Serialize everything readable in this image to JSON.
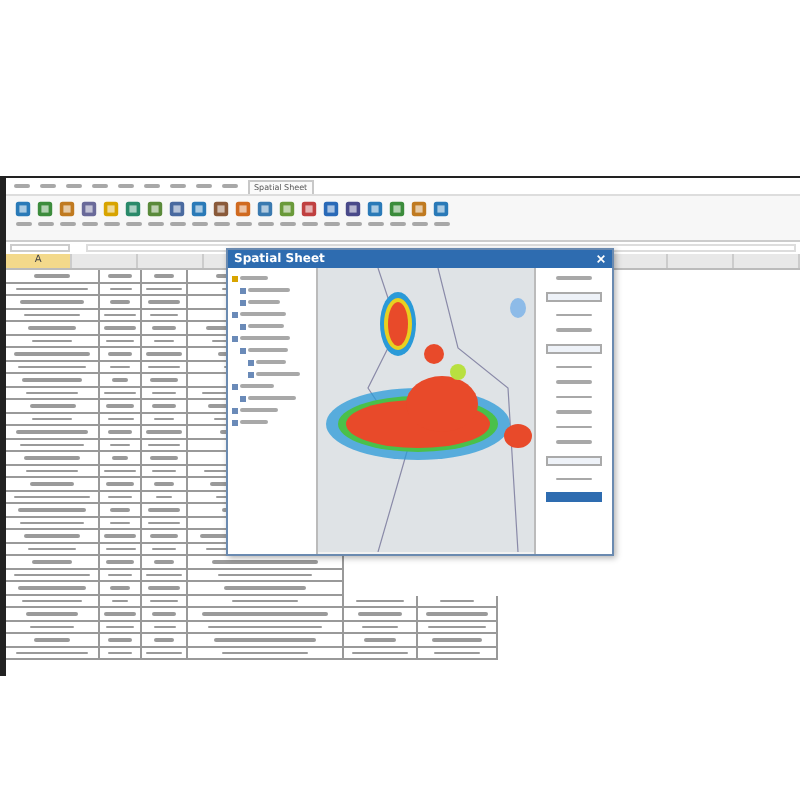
{
  "ribbon": {
    "tabs": [
      {
        "label": "Spatial Sheet",
        "selected": true
      }
    ]
  },
  "sheet": {
    "column_header": "A"
  },
  "panel": {
    "title": "Spatial Sheet"
  }
}
